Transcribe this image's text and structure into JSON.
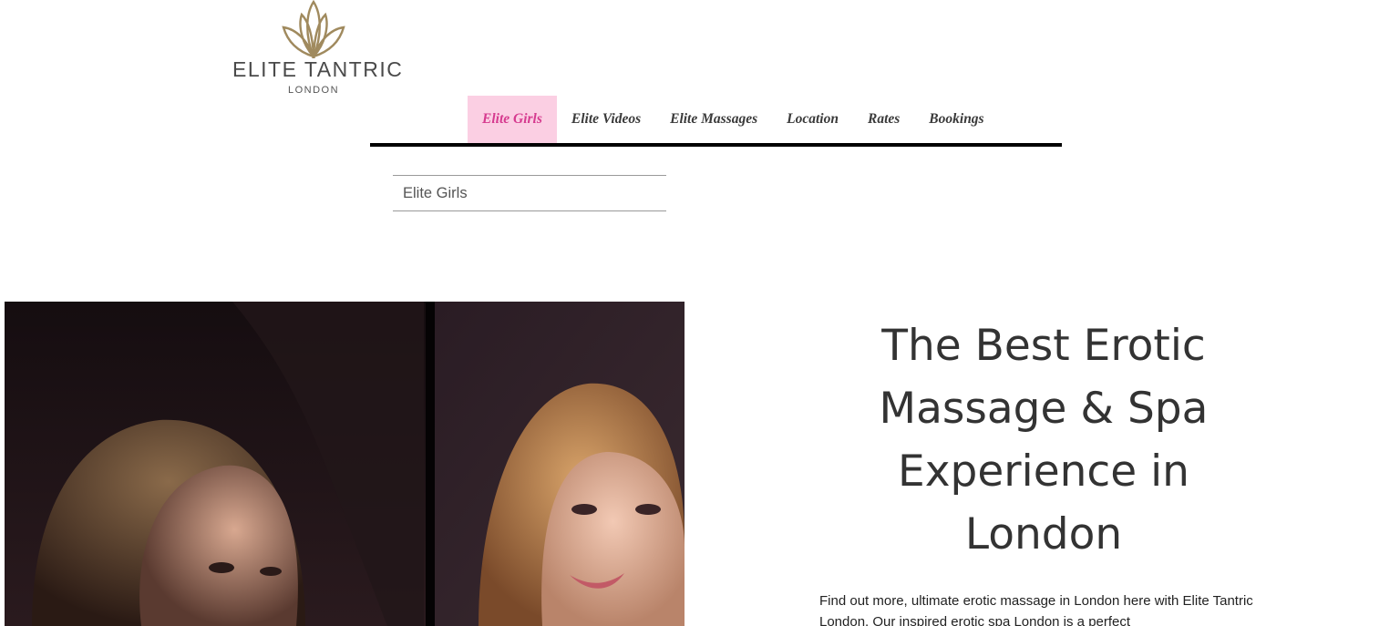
{
  "logo": {
    "name": "ELITE TANTRIC",
    "sub": "LONDON"
  },
  "nav": {
    "items": [
      {
        "label": "Elite Girls",
        "active": true
      },
      {
        "label": "Elite Videos"
      },
      {
        "label": "Elite Massages"
      },
      {
        "label": "Location"
      },
      {
        "label": "Rates"
      },
      {
        "label": "Bookings"
      }
    ]
  },
  "dropdown": {
    "label": "Elite Girls"
  },
  "hero": {
    "headline": "The Best Erotic Massage & Spa Experience in London",
    "body": "Find out more, ultimate erotic massage in London here with Elite Tantric London.  Our inspired erotic spa London is a perfect"
  },
  "colors": {
    "active_bg": "#fbcfe3",
    "active_text": "#d63a8f",
    "logo_gold": "#a08a5e"
  }
}
